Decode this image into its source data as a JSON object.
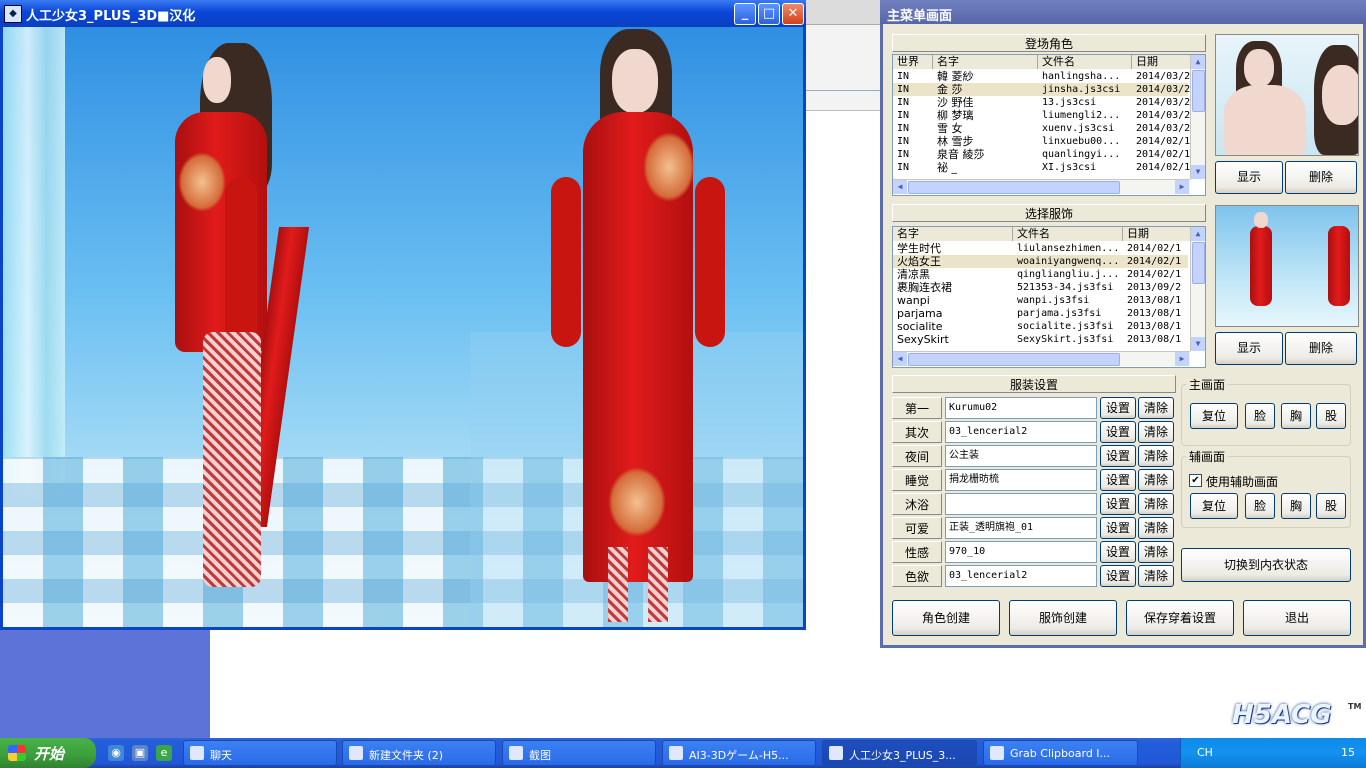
{
  "viewer": {
    "title": "人工少女3_PLUS_3D■汉化",
    "minimize_glyph": "_",
    "maximize_glyph": "□",
    "close_glyph": "✕"
  },
  "panel": {
    "title": "主菜单画面",
    "characters": {
      "heading": "登场角色",
      "columns": [
        "世界",
        "名字",
        "文件名",
        "日期"
      ],
      "rows": [
        {
          "world": "IN",
          "name": "韓 菱紗",
          "file": "hanlingsha...",
          "date": "2014/03/2"
        },
        {
          "world": "IN",
          "name": "金 莎",
          "file": "jinsha.js3csi",
          "date": "2014/03/2"
        },
        {
          "world": "IN",
          "name": "沙 野佳",
          "file": "13.js3csi",
          "date": "2014/03/2"
        },
        {
          "world": "IN",
          "name": "柳 梦璃",
          "file": "liumengli2...",
          "date": "2014/03/2"
        },
        {
          "world": "IN",
          "name": "雪 女",
          "file": "xuenv.js3csi",
          "date": "2014/03/2"
        },
        {
          "world": "IN",
          "name": "林 雪步",
          "file": "linxuebu00...",
          "date": "2014/02/1"
        },
        {
          "world": "IN",
          "name": "泉音 綾莎",
          "file": "quanlingyi...",
          "date": "2014/02/1"
        },
        {
          "world": "IN",
          "name": "祕 _",
          "file": "XI.js3csi",
          "date": "2014/02/1"
        }
      ],
      "selected_index": 1,
      "show_button": "显示",
      "delete_button": "删除"
    },
    "outfits": {
      "heading": "选择服饰",
      "columns": [
        "名字",
        "文件名",
        "日期"
      ],
      "rows": [
        {
          "name": "学生时代",
          "file": "liulansezhimen...",
          "date": "2014/02/1"
        },
        {
          "name": "火焰女王",
          "file": "woainiyangwenq...",
          "date": "2014/02/1"
        },
        {
          "name": "清凉黑",
          "file": "qingliangliu.j...",
          "date": "2014/02/1"
        },
        {
          "name": "裹胸连衣裙",
          "file": "521353-34.js3fsi",
          "date": "2013/09/2"
        },
        {
          "name": "wanpi",
          "file": "wanpi.js3fsi",
          "date": "2013/08/1"
        },
        {
          "name": "parjama",
          "file": "parjama.js3fsi",
          "date": "2013/08/1"
        },
        {
          "name": "socialite",
          "file": "socialite.js3fsi",
          "date": "2013/08/1"
        },
        {
          "name": "SexySkirt",
          "file": "SexySkirt.js3fsi",
          "date": "2013/08/1"
        }
      ],
      "selected_index": 1,
      "show_button": "显示",
      "delete_button": "删除"
    },
    "outfit_settings": {
      "heading": "服装设置",
      "set_button": "设置",
      "clear_button": "清除",
      "rows": [
        {
          "label": "第一",
          "value": "Kurumu02"
        },
        {
          "label": "其次",
          "value": "03_lencerial2"
        },
        {
          "label": "夜间",
          "value": "公主装"
        },
        {
          "label": "睡觉",
          "value": "捐龙栅昉梳"
        },
        {
          "label": "沐浴",
          "value": ""
        },
        {
          "label": "可爱",
          "value": "正装_透明旗袍_01"
        },
        {
          "label": "性感",
          "value": "970_10"
        },
        {
          "label": "色欲",
          "value": "03_lencerial2"
        }
      ]
    },
    "main_view": {
      "label": "主画面",
      "buttons": [
        "复位",
        "脸",
        "胸",
        "股"
      ]
    },
    "sub_view": {
      "label": "辅画面",
      "checkbox_label": "使用辅助画面",
      "checkbox_checked": true,
      "check_glyph": "✔",
      "buttons": [
        "复位",
        "脸",
        "胸",
        "股"
      ]
    },
    "switch_button": "切换到内衣状态",
    "bottom_buttons": [
      "角色创建",
      "服饰创建",
      "保存穿着设置",
      "退出"
    ]
  },
  "taskbar": {
    "start_label": "开始",
    "tasks": [
      {
        "label": "聊天"
      },
      {
        "label": "新建文件夹 (2)"
      },
      {
        "label": "截图"
      },
      {
        "label": "AI3-3Dゲーム-H5..."
      },
      {
        "label": "人工少女3_PLUS_3..."
      },
      {
        "label": "Grab Clipboard I..."
      }
    ],
    "active_index": 4,
    "lang": "CH",
    "clock": "15"
  },
  "watermark": {
    "text": "H5ACG",
    "tm": "TM"
  }
}
